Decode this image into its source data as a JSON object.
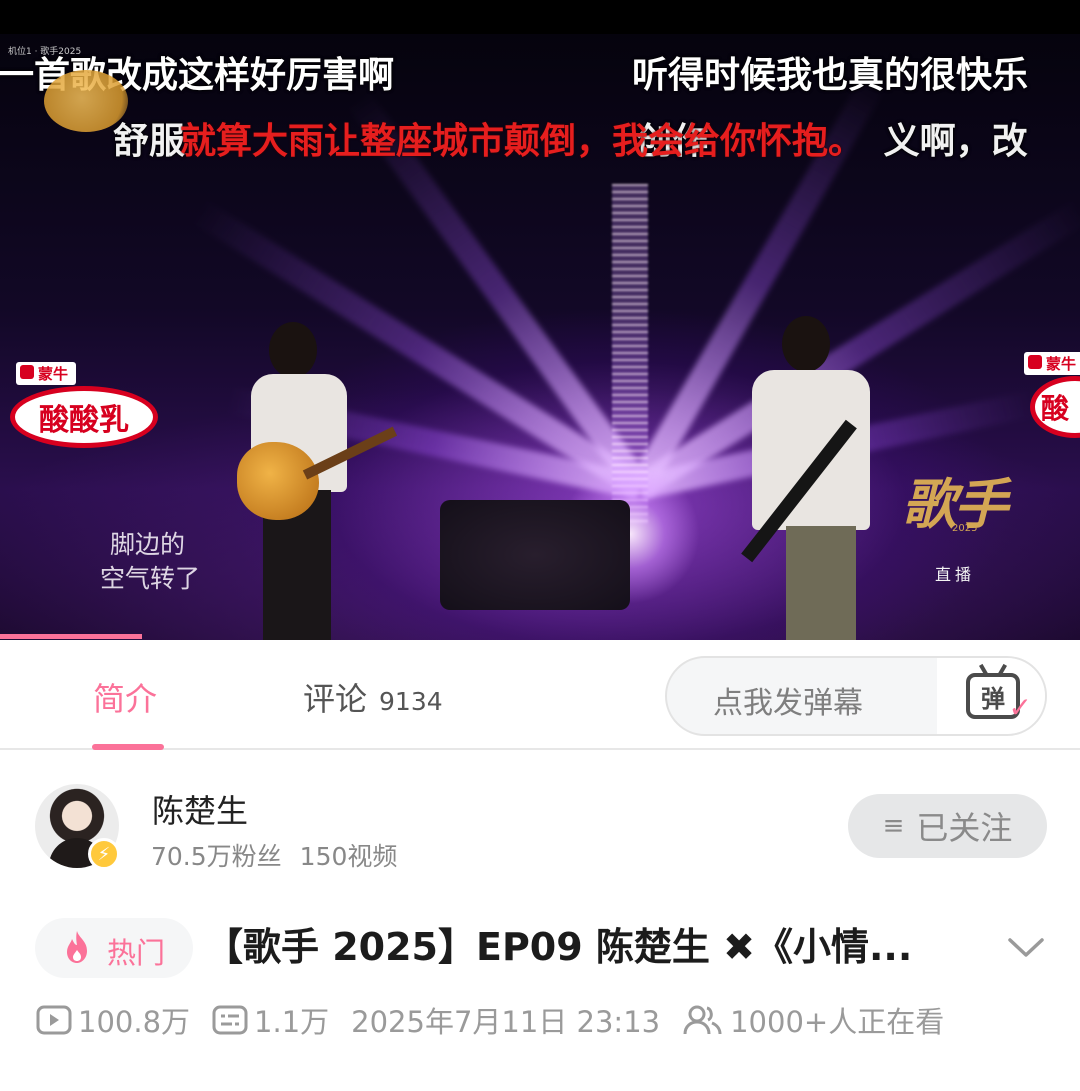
{
  "video": {
    "subtitle_top_left": "一首歌改成这样好厉害啊",
    "subtitle_top_right": "听得时候我也真的很快乐",
    "subtitle_second_line": "舒服                                    创作              义啊，改",
    "subtitle_red": "就算大雨让整座城市颠倒，我会给你怀抱。",
    "watermark": "机位1 · 歌手2025",
    "sponsor_brand": "蒙牛",
    "sponsor_product": "酸酸乳",
    "sponsor_product_right": "酸",
    "lyric_line1": "脚边的",
    "lyric_line2": "空气转了",
    "show_logo": "歌手",
    "show_year": "2025",
    "live_tag": "直播"
  },
  "tabs": {
    "intro_label": "简介",
    "comments_label": "评论",
    "comments_count": "9134"
  },
  "danmaku": {
    "placeholder": "点我发弹幕",
    "icon_char": "弹",
    "icon_check": "✓"
  },
  "uploader": {
    "name": "陈楚生",
    "fans": "70.5万粉丝",
    "videos": "150视频",
    "follow_label": "已关注",
    "follow_icon": "≡",
    "verify_icon": "⚡"
  },
  "title_row": {
    "hot_label": "热门",
    "title": "【歌手 2025】EP09 陈楚生 ✖《小情..."
  },
  "meta": {
    "views": "100.8万",
    "danmaku_count": "1.1万",
    "datetime": "2025年7月11日 23:13",
    "watching": "1000+人正在看"
  },
  "colors": {
    "accent_pink": "#fb7299",
    "text_gray": "#9a9a9a",
    "subtitle_red": "#e61e1e"
  }
}
